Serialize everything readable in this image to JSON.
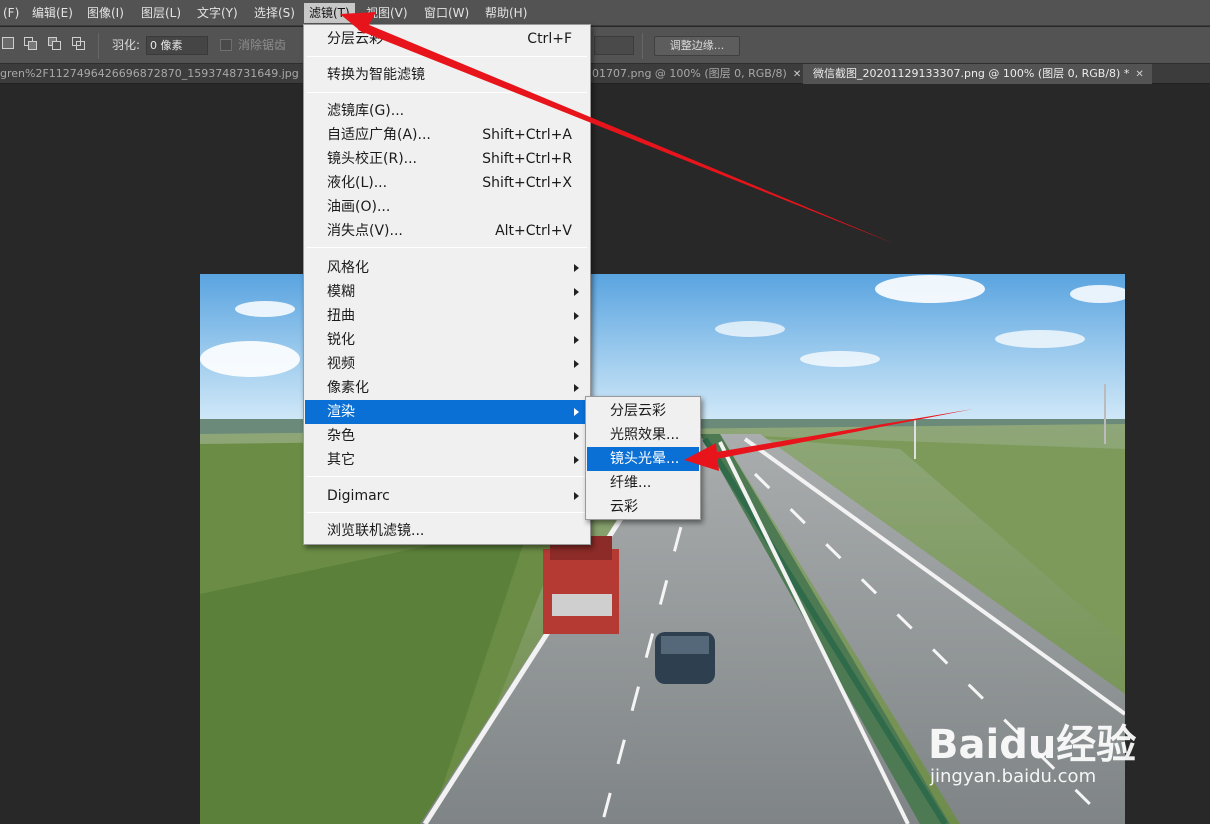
{
  "menubar": {
    "items": [
      "(F)",
      "编辑(E)",
      "图像(I)",
      "图层(L)",
      "文字(Y)",
      "选择(S)",
      "滤镜(T)",
      "视图(V)",
      "窗口(W)",
      "帮助(H)"
    ],
    "active": "滤镜(T)"
  },
  "options": {
    "feather_label": "羽化:",
    "feather_value": "0 像素",
    "antialias_label": "消除锯齿",
    "refine_edge": "调整边缘..."
  },
  "tabs": [
    {
      "label": "gren%2F1127496426696872870_1593748731649.jpg @",
      "active": false
    },
    {
      "label": "01707.png @ 100% (图层 0, RGB/8)",
      "active": false
    },
    {
      "label": "微信截图_20201129133307.png @ 100% (图层 0, RGB/8) *",
      "active": true
    }
  ],
  "filter_menu": {
    "items": [
      {
        "label": "分层云彩",
        "shortcut": "Ctrl+F"
      },
      {
        "label": "转换为智能滤镜"
      },
      {
        "label": "滤镜库(G)..."
      },
      {
        "label": "自适应广角(A)...",
        "shortcut": "Shift+Ctrl+A"
      },
      {
        "label": "镜头校正(R)...",
        "shortcut": "Shift+Ctrl+R"
      },
      {
        "label": "液化(L)...",
        "shortcut": "Shift+Ctrl+X"
      },
      {
        "label": "油画(O)..."
      },
      {
        "label": "消失点(V)...",
        "shortcut": "Alt+Ctrl+V"
      },
      {
        "label": "风格化",
        "submenu": true
      },
      {
        "label": "模糊",
        "submenu": true
      },
      {
        "label": "扭曲",
        "submenu": true
      },
      {
        "label": "锐化",
        "submenu": true
      },
      {
        "label": "视频",
        "submenu": true
      },
      {
        "label": "像素化",
        "submenu": true
      },
      {
        "label": "渲染",
        "submenu": true,
        "highlighted": true
      },
      {
        "label": "杂色",
        "submenu": true
      },
      {
        "label": "其它",
        "submenu": true
      },
      {
        "label": "Digimarc",
        "submenu": true
      },
      {
        "label": "浏览联机滤镜..."
      }
    ]
  },
  "render_submenu": {
    "items": [
      {
        "label": "分层云彩"
      },
      {
        "label": "光照效果..."
      },
      {
        "label": "镜头光晕...",
        "highlighted": true
      },
      {
        "label": "纤维..."
      },
      {
        "label": "云彩"
      }
    ]
  },
  "watermark": {
    "brand": "Baidu经验",
    "url": "jingyan.baidu.com"
  },
  "colors": {
    "menu_highlight": "#0a70d6",
    "annotation_arrow": "#e8141b",
    "ui_dark": "#282828",
    "ui_panel": "#535353"
  }
}
